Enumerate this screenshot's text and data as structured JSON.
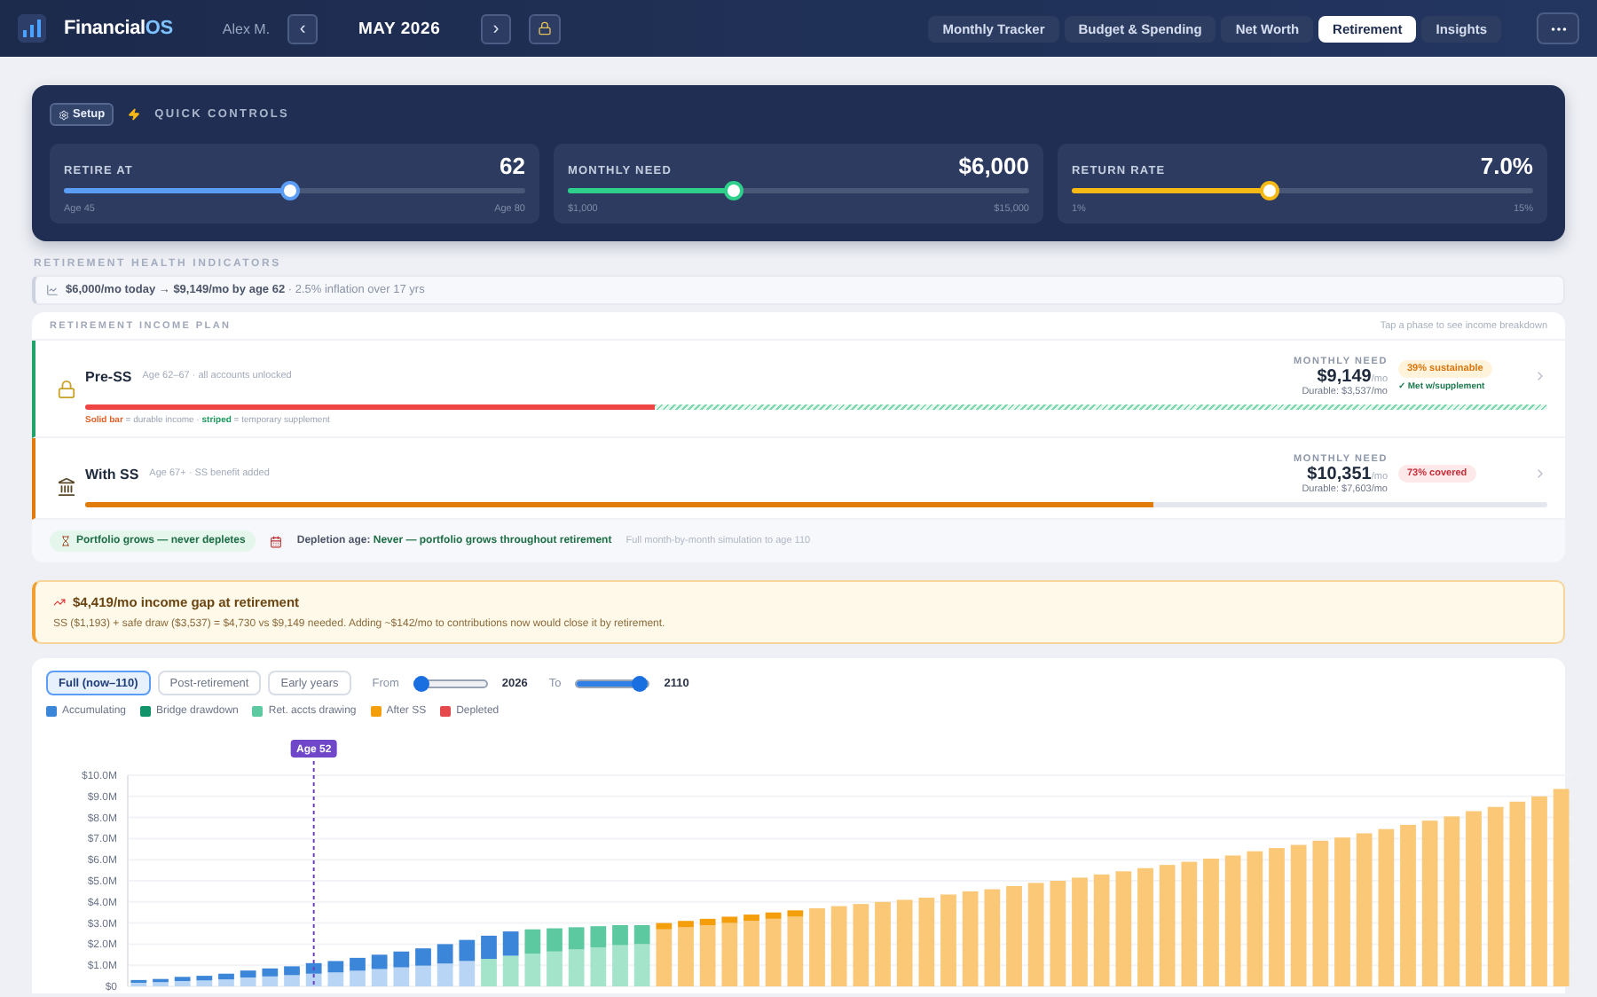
{
  "header": {
    "brand": "Financial",
    "brand_suffix": "OS",
    "user": "Alex M.",
    "prev": "‹",
    "month": "MAY 2026",
    "next": "›",
    "tabs": [
      {
        "label": "Monthly Tracker",
        "selected": false
      },
      {
        "label": "Budget & Spending",
        "selected": false
      },
      {
        "label": "Net Worth",
        "selected": false
      },
      {
        "label": "Retirement",
        "selected": true
      },
      {
        "label": "Insights",
        "selected": false
      }
    ]
  },
  "quick_controls": {
    "setup": "Setup",
    "title": "QUICK CONTROLS",
    "sliders": [
      {
        "label": "RETIRE AT",
        "value": "62",
        "min": "Age 45",
        "max": "Age 80",
        "level": 0.49,
        "color": "#5b9cf5"
      },
      {
        "label": "MONTHLY NEED",
        "value": "$6,000",
        "min": "$1,000",
        "max": "$15,000",
        "level": 0.36,
        "color": "#2ecf8a"
      },
      {
        "label": "RETURN RATE",
        "value": "7.0%",
        "min": "1%",
        "max": "15%",
        "level": 0.43,
        "color": "#f5b815"
      }
    ]
  },
  "health": {
    "title": "RETIREMENT HEALTH INDICATORS",
    "inflation": "**$6,000/mo today → $9,149/mo by age 62** · 2.5% inflation over 17 yrs"
  },
  "income_plan": {
    "title": "RETIREMENT INCOME PLAN",
    "hint": "Tap a phase to see income breakdown",
    "phases": [
      {
        "kind": "split",
        "name": "Pre-SS",
        "detail": "Age 62–67 · all accounts unlocked",
        "color": "#1fa36b",
        "level": 0.39,
        "legend": [
          {
            "text": "Solid bar",
            "kind": "solid"
          },
          {
            "text": " = durable income · ",
            "kind": "plain"
          },
          {
            "text": "striped",
            "kind": "striped"
          },
          {
            "text": " = temporary supplement",
            "kind": "plain"
          }
        ],
        "need_label": "MONTHLY NEED",
        "need": "$9,149",
        "unit": "/mo",
        "durable": "Durable: $3,537/mo",
        "badge": "39% sustainable",
        "note": "✓ Met w/supplement"
      },
      {
        "kind": "plain",
        "name": "With SS",
        "detail": "Age 67+ · SS benefit added",
        "color": "#e07b0c",
        "level": 0.73,
        "need_label": "MONTHLY NEED",
        "need": "$10,351",
        "unit": "/mo",
        "durable": "Durable: $7,603/mo",
        "badge": "73% covered"
      }
    ],
    "footer": {
      "pill": "Portfolio grows — never depletes",
      "depletion_label": "Depletion age:",
      "depletion_value": "Never — portfolio grows throughout retirement",
      "note": "Full month-by-month simulation to age 110"
    }
  },
  "gap_alert": {
    "title": "$4,419/mo income gap at retirement",
    "text": "SS ($1,193) + safe draw ($3,537) = $4,730 vs $9,149 needed. Adding ~$142/mo to contributions now would close it by retirement."
  },
  "projection": {
    "views": [
      {
        "label": "Full (now–110)",
        "selected": true
      },
      {
        "label": "Post-retirement",
        "selected": false
      },
      {
        "label": "Early years",
        "selected": false
      }
    ],
    "from_label": "From",
    "from": {
      "level": 0.08
    },
    "from_value": "2026",
    "to_label": "To",
    "to": {
      "level": 0.88
    },
    "to_value": "2110",
    "legend": [
      {
        "label": "Accumulating",
        "color": "#3b86d8"
      },
      {
        "label": "Bridge drawdown",
        "color": "#12936a"
      },
      {
        "label": "Ret. accts drawing",
        "color": "#5cc9a0"
      },
      {
        "label": "After SS",
        "color": "#f59e0b"
      },
      {
        "label": "Depleted",
        "color": "#e5484d"
      }
    ],
    "marker_label": "Age 52",
    "chart_data": {
      "type": "bar",
      "stacked": true,
      "grid": true,
      "ylim": [
        0,
        10
      ],
      "yticks": [
        {
          "value": 0,
          "label": "$0"
        },
        {
          "value": 1,
          "label": "$1.0M"
        },
        {
          "value": 2,
          "label": "$2.0M"
        },
        {
          "value": 3,
          "label": "$3.0M"
        },
        {
          "value": 4,
          "label": "$4.0M"
        },
        {
          "value": 5,
          "label": "$5.0M"
        },
        {
          "value": 6,
          "label": "$6.0M"
        },
        {
          "value": 7,
          "label": "$7.0M"
        },
        {
          "value": 8,
          "label": "$8.0M"
        },
        {
          "value": 9,
          "label": "$9.0M"
        },
        {
          "value": 10,
          "label": "$10.0M"
        }
      ],
      "series": [
        {
          "color": "#b9d5f6",
          "values": [
            0.17,
            0.2,
            0.25,
            0.28,
            0.33,
            0.42,
            0.47,
            0.53,
            0.6,
            0.66,
            0.74,
            0.82,
            0.9,
            0.98,
            1.08,
            1.2,
            null,
            null,
            null,
            null,
            null,
            null,
            null,
            null,
            null,
            null,
            null,
            null,
            null,
            null,
            null,
            null,
            null,
            null,
            null,
            null,
            null,
            null,
            null,
            null,
            null,
            null,
            null,
            null,
            null,
            null,
            null,
            null,
            null,
            null,
            null,
            null,
            null,
            null,
            null,
            null,
            null,
            null,
            null,
            null,
            null,
            null,
            null,
            null,
            null,
            null
          ]
        },
        {
          "color": "#a3e4ca",
          "values": [
            null,
            null,
            null,
            null,
            null,
            null,
            null,
            null,
            null,
            null,
            null,
            null,
            null,
            null,
            null,
            null,
            1.3,
            1.45,
            1.55,
            1.65,
            1.75,
            1.85,
            1.95,
            2.0,
            null,
            null,
            null,
            null,
            null,
            null,
            null,
            null,
            null,
            null,
            null,
            null,
            null,
            null,
            null,
            null,
            null,
            null,
            null,
            null,
            null,
            null,
            null,
            null,
            null,
            null,
            null,
            null,
            null,
            null,
            null,
            null,
            null,
            null,
            null,
            null,
            null,
            null,
            null,
            null,
            null,
            null
          ]
        },
        {
          "color": "#fbc878",
          "values": [
            null,
            null,
            null,
            null,
            null,
            null,
            null,
            null,
            null,
            null,
            null,
            null,
            null,
            null,
            null,
            null,
            null,
            null,
            null,
            null,
            null,
            null,
            null,
            null,
            2.7,
            2.8,
            2.9,
            3.0,
            3.1,
            3.2,
            3.3,
            3.7,
            3.8,
            3.9,
            4.0,
            4.1,
            4.2,
            4.35,
            4.5,
            4.6,
            4.75,
            4.9,
            5.0,
            5.15,
            5.3,
            5.45,
            5.6,
            5.75,
            5.9,
            6.05,
            6.2,
            6.4,
            6.55,
            6.7,
            6.9,
            7.05,
            7.25,
            7.45,
            7.65,
            7.85,
            8.05,
            8.3,
            8.5,
            8.75,
            9.0,
            9.35
          ]
        },
        {
          "color": "#3b86d8",
          "values": [
            0.13,
            0.15,
            0.2,
            0.22,
            0.27,
            0.33,
            0.38,
            0.42,
            0.5,
            0.54,
            0.61,
            0.68,
            0.75,
            0.82,
            0.92,
            1.0,
            1.1,
            1.15,
            null,
            null,
            null,
            null,
            null,
            null,
            null,
            null,
            null,
            null,
            null,
            null,
            null,
            null,
            null,
            null,
            null,
            null,
            null,
            null,
            null,
            null,
            null,
            null,
            null,
            null,
            null,
            null,
            null,
            null,
            null,
            null,
            null,
            null,
            null,
            null,
            null,
            null,
            null,
            null,
            null,
            null,
            null,
            null,
            null,
            null,
            null,
            null
          ]
        },
        {
          "color": "#5cc9a0",
          "values": [
            null,
            null,
            null,
            null,
            null,
            null,
            null,
            null,
            null,
            null,
            null,
            null,
            null,
            null,
            null,
            null,
            null,
            null,
            1.15,
            1.1,
            1.05,
            1.0,
            0.95,
            0.9,
            null,
            null,
            null,
            null,
            null,
            null,
            null,
            null,
            null,
            null,
            null,
            null,
            null,
            null,
            null,
            null,
            null,
            null,
            null,
            null,
            null,
            null,
            null,
            null,
            null,
            null,
            null,
            null,
            null,
            null,
            null,
            null,
            null,
            null,
            null,
            null,
            null,
            null,
            null,
            null,
            null,
            null
          ]
        },
        {
          "color": "#f59e0b",
          "values": [
            null,
            null,
            null,
            null,
            null,
            null,
            null,
            null,
            null,
            null,
            null,
            null,
            null,
            null,
            null,
            null,
            null,
            null,
            null,
            null,
            null,
            null,
            null,
            null,
            0.3,
            0.3,
            0.3,
            0.3,
            0.3,
            0.3,
            0.3,
            null,
            null,
            null,
            null,
            null,
            null,
            null,
            null,
            null,
            null,
            null,
            null,
            null,
            null,
            null,
            null,
            null,
            null,
            null,
            null,
            null,
            null,
            null,
            null,
            null,
            null,
            null,
            null,
            null,
            null,
            null,
            null,
            null,
            null,
            null
          ]
        }
      ]
    }
  }
}
